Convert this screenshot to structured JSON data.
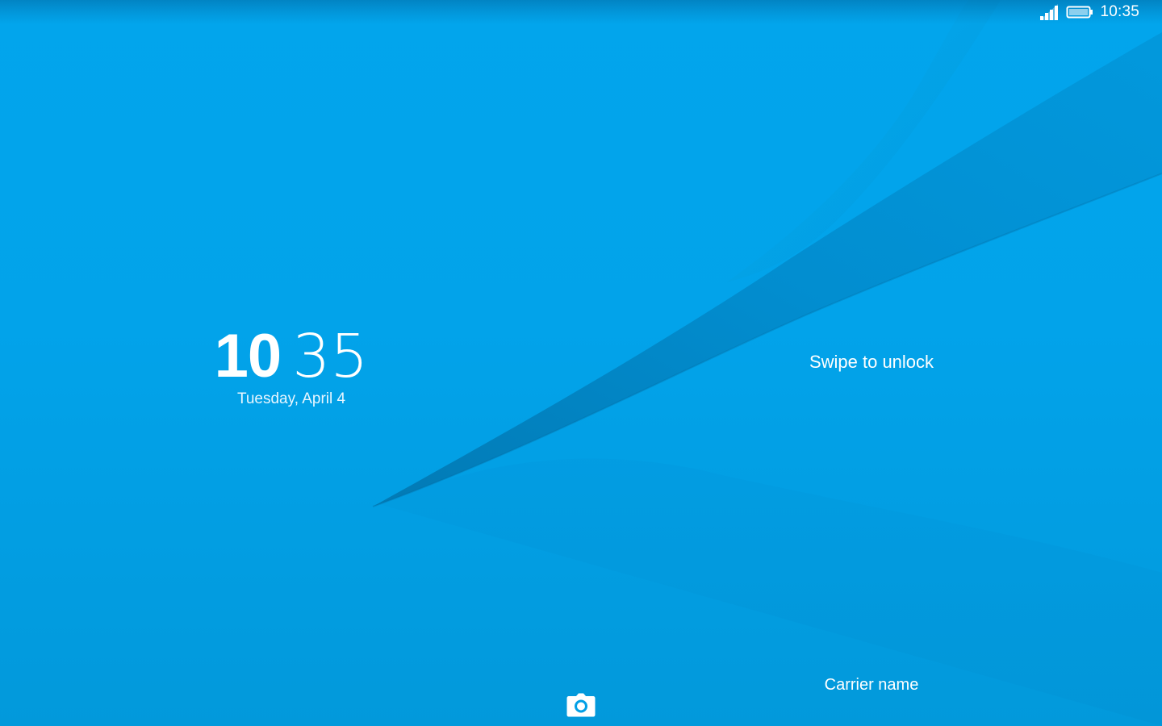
{
  "status_bar": {
    "time": "10:35",
    "signal_icon": "cellular-signal-icon",
    "battery_icon": "battery-icon"
  },
  "clock": {
    "hours": "10",
    "minutes": "35",
    "date": "Tuesday, April 4"
  },
  "lock_screen": {
    "swipe_hint": "Swipe to unlock",
    "carrier": "Carrier name",
    "camera_icon": "camera-icon"
  },
  "colors": {
    "wallpaper": "#02a3ea",
    "wallpaper_dark": "#0288c7",
    "text": "#ffffff"
  }
}
